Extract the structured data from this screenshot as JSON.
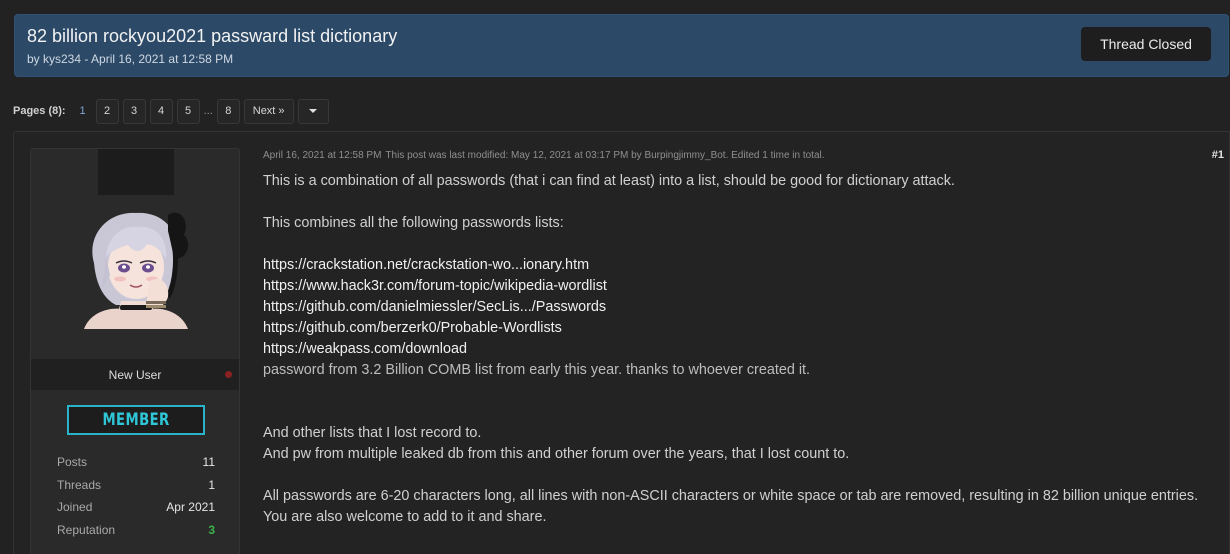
{
  "thread": {
    "title": "82 billion rockyou2021 passward list dictionary",
    "meta": "by kys234 - April 16, 2021 at 12:58 PM",
    "status_button": "Thread Closed"
  },
  "pagination": {
    "label": "Pages (8):",
    "pages": [
      "1",
      "2",
      "3",
      "4",
      "5"
    ],
    "current": "1",
    "ellipsis": "...",
    "last": "8",
    "next": "Next »"
  },
  "post": {
    "date": "April 16, 2021 at 12:58 PM",
    "modified": "This post was last modified: May 12, 2021 at 03:17 PM by Burpingjimmy_Bot. Edited 1 time in total.",
    "number": "#1",
    "body": {
      "intro": "This is a combination of all passwords (that i can find at least) into a list, should be good for dictionary attack.",
      "combines": "This combines all the following passwords lists:",
      "links": [
        "https://crackstation.net/crackstation-wo...ionary.htm",
        "https://www.hack3r.com/forum-topic/wikipedia-wordlist",
        "https://github.com/danielmiessler/SecLis.../Passwords",
        "https://github.com/berzerk0/Probable-Wordlists",
        "https://weakpass.com/download"
      ],
      "comb": "password from 3.2 Billion COMB list from early this year. thanks to whoever created it.",
      "other_lists": "And other lists that I lost record to.",
      "leaked": "And pw from multiple leaked db from this and other forum over the years, that I lost count to.",
      "all_pw": "All passwords are 6-20 characters long, all lines with non-ASCII characters or white space or tab are removed, resulting in 82 billion unique entries.",
      "welcome": "You are also welcome to add to it and share."
    }
  },
  "user": {
    "title": "New User",
    "rank": "MEMBER",
    "rank_color": "#2fc6d8",
    "status_color": "#8a2222",
    "stats": [
      {
        "label": "Posts",
        "value": "11"
      },
      {
        "label": "Threads",
        "value": "1"
      },
      {
        "label": "Joined",
        "value": "Apr 2021"
      },
      {
        "label": "Reputation",
        "value": "3"
      }
    ]
  },
  "colors": {
    "header_bg": "#2c4a68",
    "page_bg": "#222222",
    "positive": "#3ab54a",
    "current_page": "#7fa6d6"
  }
}
